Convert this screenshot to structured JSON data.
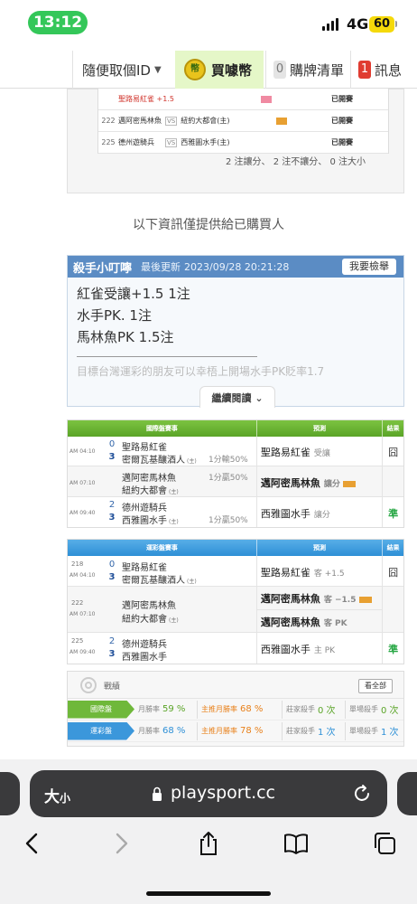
{
  "status": {
    "time": "13:12",
    "network": "4G",
    "battery": "60"
  },
  "nav": {
    "random_id": "隨便取個ID",
    "buy_coins": "買噱幣",
    "cart_count": "0",
    "cart_label": "購牌清單",
    "msg_count": "1",
    "msg_label": "訊息"
  },
  "purchased_list": {
    "rows": [
      {
        "id": "",
        "home": "聖路易紅雀 +1.5",
        "vs": "",
        "away": "",
        "tag": "pink",
        "result": "已開賽"
      },
      {
        "id": "222",
        "home": "邁阿密馬林魚",
        "vs": "VS",
        "away": "紐約大都會(主)",
        "tag": "orange",
        "result": "已開賽"
      },
      {
        "id": "225",
        "home": "德州遊騎兵",
        "vs": "VS",
        "away": "西雅圖水手(主)",
        "tag": "",
        "result": "已開賽"
      }
    ],
    "summary": "2 注讓分、 2 注不讓分、 0 注大小"
  },
  "notice": "以下資訊僅提供給已購買人",
  "tip": {
    "name": "殺手小叮嚀",
    "updated_label": "最後更新",
    "updated": "2023/09/28 20:21:28",
    "report": "我要檢舉",
    "lines": [
      "紅雀受讓+1.5 1注",
      "水手PK. 1注",
      "馬林魚PK 1.5注"
    ],
    "faded": "目標台灣運彩的朋友可以幸梧上開場水手PK貶率1.7",
    "more": "繼續閱讀"
  },
  "intl_table": {
    "head_event": "國際盤賽事",
    "head_pred": "預測",
    "head_res": "結果",
    "rows": [
      {
        "time": "AM 04:10",
        "s1": "0",
        "s2": "3",
        "t1": "聖路易紅雀",
        "t2": "密爾瓦基釀酒人",
        "sub": "(主)",
        "line": "1分輸50%",
        "pick": "聖路易紅雀",
        "kind": "受讓",
        "mark": false,
        "res": "囧",
        "res_type": "lose"
      },
      {
        "time": "AM 07:10",
        "s1": "",
        "s2": "",
        "t1": "邁阿密馬林魚",
        "t2": "紐約大都會",
        "sub": "(主)",
        "line": "1分贏50%",
        "pick": "邁阿密馬林魚",
        "kind": "讓分",
        "mark": true,
        "res": "",
        "res_type": ""
      },
      {
        "time": "AM 09:40",
        "s1": "2",
        "s2": "3",
        "t1": "德州遊騎兵",
        "t2": "西雅圖水手",
        "sub": "(主)",
        "line": "1分贏50%",
        "pick": "西雅圖水手",
        "kind": "讓分",
        "mark": false,
        "res": "準",
        "res_type": "win"
      }
    ]
  },
  "tw_table": {
    "head_event": "運彩盤賽事",
    "head_pred": "預測",
    "head_res": "結果",
    "rows": [
      {
        "num": "218",
        "time": "AM 04:10",
        "s1": "0",
        "s2": "3",
        "t1": "聖路易紅雀",
        "t2": "密爾瓦基釀酒人",
        "sub": "(主)",
        "picks": [
          {
            "pick": "聖路易紅雀",
            "kind": "客 +1.5",
            "mark": false
          }
        ],
        "res": "囧",
        "res_type": "lose"
      },
      {
        "num": "222",
        "time": "AM 07:10",
        "s1": "",
        "s2": "",
        "t1": "邁阿密馬林魚",
        "t2": "紐約大都會",
        "sub": "(主)",
        "picks": [
          {
            "pick": "邁阿密馬林魚",
            "kind": "客 −1.5",
            "mark": true
          },
          {
            "pick": "邁阿密馬林魚",
            "kind": "客 PK",
            "mark": false
          }
        ],
        "res": "",
        "res_type": ""
      },
      {
        "num": "225",
        "time": "AM 09:40",
        "s1": "2",
        "s2": "3",
        "t1": "德州遊騎兵",
        "t2": "西雅圖水手",
        "sub": "",
        "picks": [
          {
            "pick": "西雅圖水手",
            "kind": "主 PK",
            "mark": false
          }
        ],
        "res": "準",
        "res_type": "win"
      }
    ]
  },
  "record": {
    "title": "戰績",
    "view_all": "看全部",
    "rows": [
      {
        "label": "國際盤",
        "month_label": "月勝率",
        "month": "59 %",
        "main_label": "主推月勝率",
        "main": "68 %",
        "single_label": "莊家殺手",
        "single": "0 次",
        "last_label": "單場殺手",
        "last": "0 次"
      },
      {
        "label": "運彩盤",
        "month_label": "月勝率",
        "month": "68 %",
        "main_label": "主推月勝率",
        "main": "78 %",
        "single_label": "莊家殺手",
        "single": "1 次",
        "last_label": "單場殺手",
        "last": "1 次"
      }
    ]
  },
  "browser": {
    "aa": "大",
    "aa_small": "小",
    "url": "playsport.cc"
  }
}
